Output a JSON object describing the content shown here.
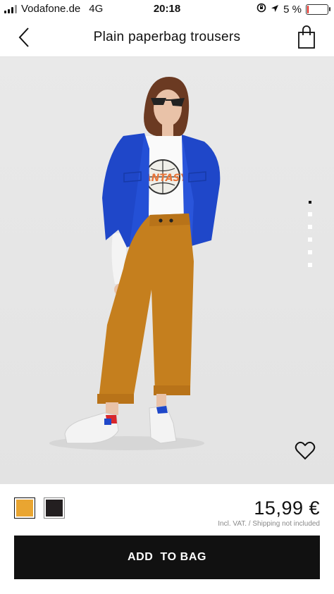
{
  "status_bar": {
    "carrier": "Vodafone.de",
    "network": "4G",
    "time": "20:18",
    "battery_percent": "5 %",
    "battery_level": 0.05
  },
  "nav": {
    "title": "Plain paperbag trousers",
    "back_icon": "chevron-left-icon",
    "bag_icon": "shopping-bag-icon"
  },
  "gallery": {
    "image_count": 6,
    "active_index": 0,
    "wishlist_icon": "heart-icon"
  },
  "product": {
    "swatches": [
      {
        "color": "#e9a531",
        "selected": true
      },
      {
        "color": "#231f20",
        "selected": false
      }
    ],
    "price": "15,99 €",
    "tax_note": "Incl. VAT. / Shipping not included"
  },
  "cta": {
    "label": "ADD  TO BAG"
  },
  "colors": {
    "accent": "#111111",
    "battery_low": "#e2231a"
  }
}
